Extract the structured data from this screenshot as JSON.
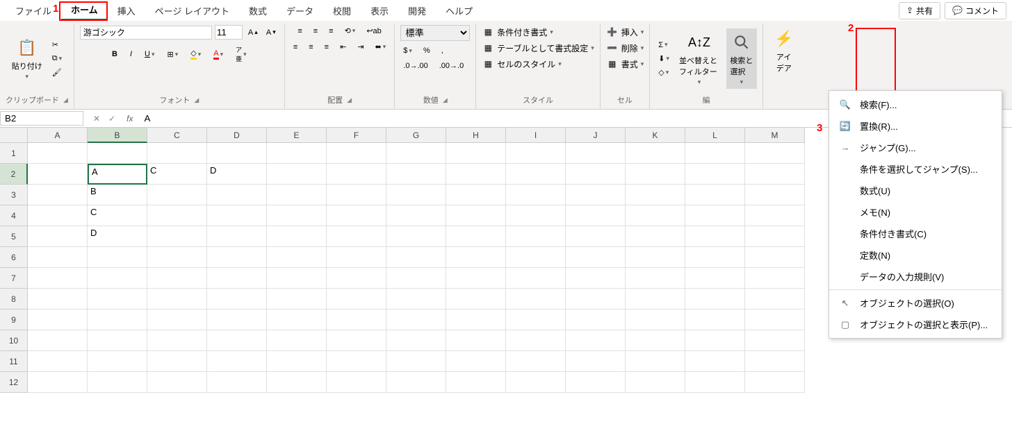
{
  "tabs": {
    "file": "ファイル",
    "home": "ホーム",
    "insert": "挿入",
    "layout": "ページ レイアウト",
    "formulas": "数式",
    "data": "データ",
    "review": "校閲",
    "view": "表示",
    "developer": "開発",
    "help": "ヘルプ"
  },
  "top_right": {
    "share": "共有",
    "comment": "コメント"
  },
  "annotations": {
    "a1": "1",
    "a2": "2",
    "a3": "3"
  },
  "groups": {
    "clipboard": {
      "paste": "貼り付け",
      "label": "クリップボード"
    },
    "font": {
      "name": "游ゴシック",
      "size": "11",
      "label": "フォント"
    },
    "align": {
      "label": "配置"
    },
    "number": {
      "format": "標準",
      "label": "数値"
    },
    "styles": {
      "cond": "条件付き書式 ",
      "table": "テーブルとして書式設定 ",
      "cell": "セルのスタイル ",
      "label": "スタイル"
    },
    "cells": {
      "insert": "挿入 ",
      "delete": "削除 ",
      "format": "書式 ",
      "label": "セル"
    },
    "editing": {
      "sort": "並べ替えと\nフィルター ",
      "find": "検索と\n選択 ",
      "label": "編"
    },
    "ideas": {
      "label": "アイ\nデア"
    }
  },
  "namebox": {
    "ref": "B2",
    "formula": "A"
  },
  "columns": [
    "A",
    "B",
    "C",
    "D",
    "E",
    "F",
    "G",
    "H",
    "I",
    "J",
    "K",
    "L",
    "M"
  ],
  "rows": [
    "1",
    "2",
    "3",
    "4",
    "5",
    "6",
    "7",
    "8",
    "9",
    "10",
    "11",
    "12"
  ],
  "cells": {
    "B2": "A",
    "C2": "C",
    "D2": "D",
    "B3": "B",
    "B4": "C",
    "B5": "D"
  },
  "menu": {
    "find": "検索(F)...",
    "replace": "置換(R)...",
    "goto": "ジャンプ(G)...",
    "goto_special": "条件を選択してジャンプ(S)...",
    "formulas": "数式(U)",
    "notes": "メモ(N)",
    "cond_fmt": "条件付き書式(C)",
    "constants": "定数(N)",
    "validation": "データの入力規則(V)",
    "select_obj": "オブジェクトの選択(O)",
    "selection_pane": "オブジェクトの選択と表示(P)..."
  }
}
